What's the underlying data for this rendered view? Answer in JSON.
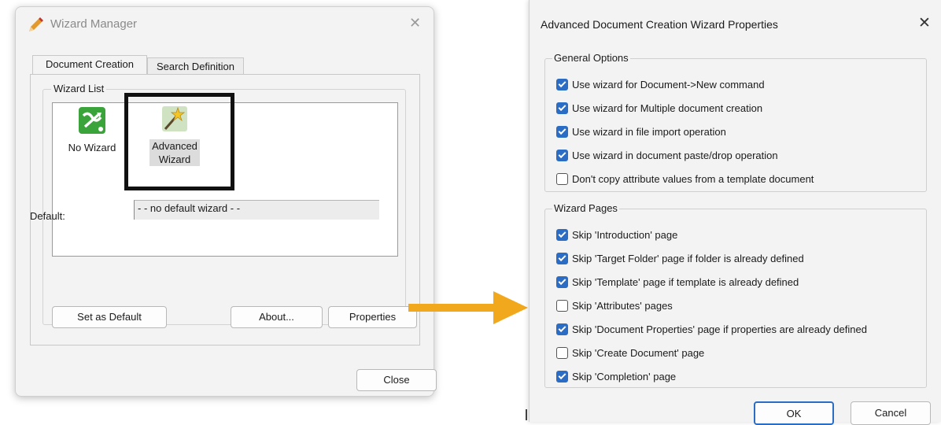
{
  "wizard_manager": {
    "title": "Wizard Manager",
    "close_glyph": "✕",
    "tabs": [
      "Document Creation",
      "Search Definition"
    ],
    "wizard_list_label": "Wizard List",
    "items": [
      {
        "label": "No Wizard",
        "icon": "no-wizard-icon"
      },
      {
        "label_line1": "Advanced",
        "label_line2": "Wizard",
        "icon": "magic-wand-icon"
      }
    ],
    "default_label": "Default:",
    "default_value": "- - no default wizard - -",
    "buttons": {
      "set_default": "Set as Default",
      "about": "About...",
      "properties": "Properties",
      "close": "Close"
    }
  },
  "properties_dialog": {
    "title": "Advanced Document Creation Wizard Properties",
    "close_glyph": "✕",
    "general_options": {
      "legend": "General Options",
      "items": [
        {
          "label": "Use wizard for Document->New command",
          "checked": true
        },
        {
          "label": "Use wizard for Multiple document creation",
          "checked": true
        },
        {
          "label": "Use wizard in file import operation",
          "checked": true
        },
        {
          "label": "Use wizard in document paste/drop operation",
          "checked": true
        },
        {
          "label": "Don't copy attribute values from a template document",
          "checked": false
        }
      ]
    },
    "wizard_pages": {
      "legend": "Wizard Pages",
      "items": [
        {
          "label": "Skip 'Introduction' page",
          "checked": true
        },
        {
          "label": "Skip 'Target Folder' page if folder is already defined",
          "checked": true
        },
        {
          "label": "Skip 'Template' page if template is already defined",
          "checked": true
        },
        {
          "label": "Skip 'Attributes' pages",
          "checked": false
        },
        {
          "label": "Skip 'Document Properties' page if properties are already defined",
          "checked": true
        },
        {
          "label": "Skip 'Create Document' page",
          "checked": false
        },
        {
          "label": "Skip 'Completion' page",
          "checked": true
        }
      ]
    },
    "buttons": {
      "ok": "OK",
      "cancel": "Cancel"
    }
  },
  "colors": {
    "accent": "#2b6cc4",
    "arrow": "#f2a81d",
    "highlight": "#111111"
  }
}
